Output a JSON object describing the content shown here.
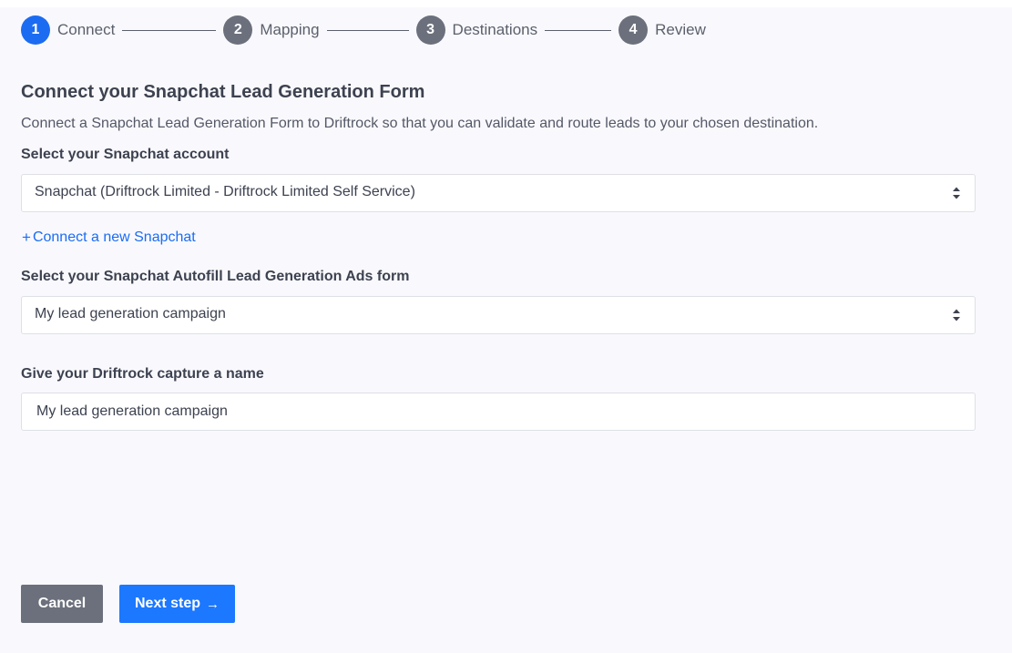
{
  "stepper": {
    "steps": [
      {
        "number": "1",
        "label": "Connect",
        "state": "active"
      },
      {
        "number": "2",
        "label": "Mapping",
        "state": "upcoming"
      },
      {
        "number": "3",
        "label": "Destinations",
        "state": "upcoming"
      },
      {
        "number": "4",
        "label": "Review",
        "state": "upcoming"
      }
    ]
  },
  "page": {
    "title": "Connect your Snapchat Lead Generation Form",
    "subtitle": "Connect a Snapchat Lead Generation Form to Driftrock so that you can validate and route leads to your chosen destination."
  },
  "account": {
    "label": "Select your Snapchat account",
    "selected": "Snapchat (Driftrock Limited - Driftrock Limited Self Service)",
    "connect_icon": "+",
    "connect_link": "Connect a new Snapchat"
  },
  "form": {
    "label": "Select your Snapchat Autofill Lead Generation Ads form",
    "selected": "My lead generation campaign"
  },
  "capture_name": {
    "label": "Give your Driftrock capture a name",
    "value": "My lead generation campaign"
  },
  "buttons": {
    "cancel": "Cancel",
    "next": "Next step",
    "next_icon": "→"
  },
  "colors": {
    "primary": "#1c78ff",
    "active_step": "#1c6cf2",
    "inactive_step": "#6b707c",
    "link": "#1c6cf2"
  },
  "icons": {
    "select_caret": "sort-caret-icon",
    "next_arrow": "arrow-right-icon",
    "connect_plus": "plus-icon"
  }
}
